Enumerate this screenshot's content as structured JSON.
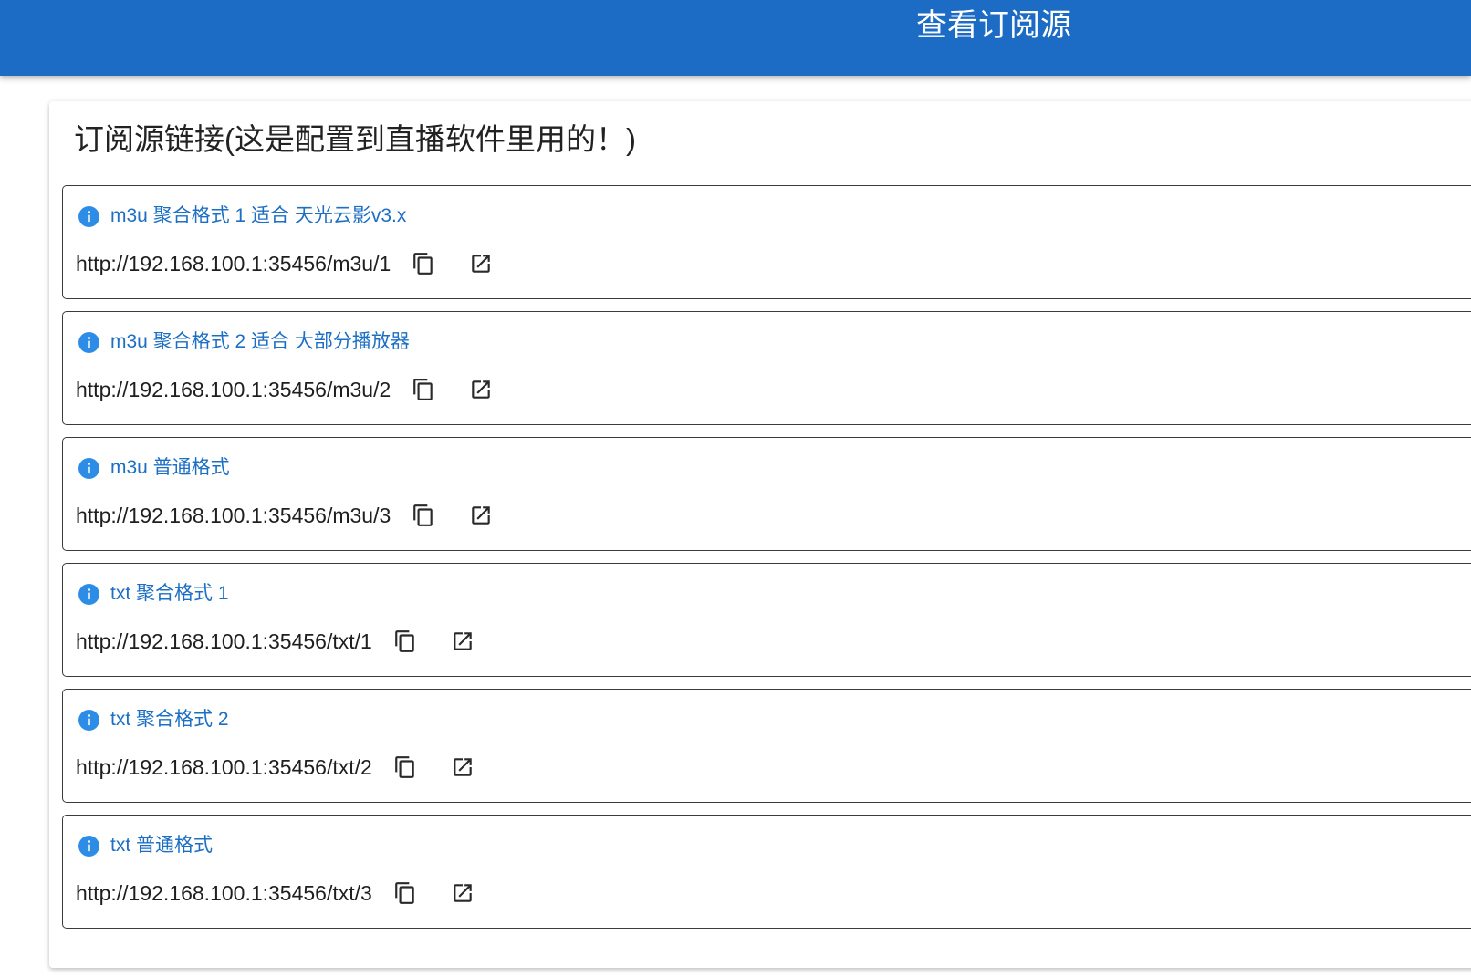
{
  "app_bar": {
    "title": "查看订阅源",
    "color": "#1c6bc4"
  },
  "card": {
    "title": "订阅源链接(这是配置到直播软件里用的！)"
  },
  "links": [
    {
      "label": "m3u 聚合格式 1 适合 天光云影v3.x",
      "url": "http://192.168.100.1:35456/m3u/1"
    },
    {
      "label": "m3u 聚合格式 2 适合 大部分播放器",
      "url": "http://192.168.100.1:35456/m3u/2"
    },
    {
      "label": "m3u 普通格式",
      "url": "http://192.168.100.1:35456/m3u/3"
    },
    {
      "label": "txt 聚合格式 1",
      "url": "http://192.168.100.1:35456/txt/1"
    },
    {
      "label": "txt 聚合格式 2",
      "url": "http://192.168.100.1:35456/txt/2"
    },
    {
      "label": "txt 普通格式",
      "url": "http://192.168.100.1:35456/txt/3"
    }
  ],
  "icons": {
    "info": "info-icon",
    "copy": "copy-icon",
    "open": "open-in-new-icon"
  },
  "colors": {
    "info_icon": "#2d8ce6",
    "label_text": "#1d6fc4",
    "url_text": "#1f1f1f"
  }
}
